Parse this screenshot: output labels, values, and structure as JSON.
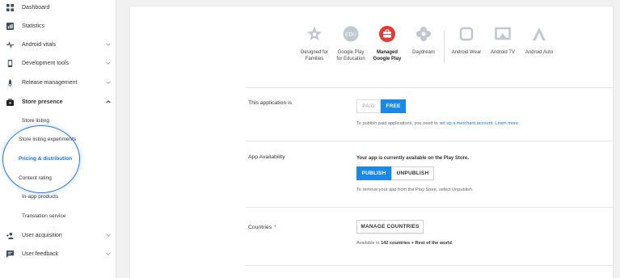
{
  "sidebar": {
    "items": [
      {
        "label": "Dashboard",
        "icon": "dashboard-icon",
        "chevron": false
      },
      {
        "label": "Statistics",
        "icon": "statistics-icon",
        "chevron": false
      },
      {
        "label": "Android vitals",
        "icon": "vitals-icon",
        "chevron": true
      },
      {
        "label": "Development tools",
        "icon": "dev-tools-icon",
        "chevron": true
      },
      {
        "label": "Release management",
        "icon": "rocket-icon",
        "chevron": true
      },
      {
        "label": "Store presence",
        "icon": "store-icon",
        "chevron": "up"
      },
      {
        "label": "User acquisition",
        "icon": "user-add-icon",
        "chevron": true
      },
      {
        "label": "User feedback",
        "icon": "feedback-icon",
        "chevron": true
      }
    ],
    "store_presence_sub": [
      "Store listing",
      "Store listing experiments",
      "Pricing & distribution",
      "Content rating",
      "In-app products",
      "Translation service"
    ],
    "active_sub": "Pricing & distribution"
  },
  "devices": [
    {
      "line1": "Designed for",
      "line2": "Families",
      "icon": "families-star-icon",
      "color": "#c2c8cf",
      "bold": false
    },
    {
      "line1": "Google Play",
      "line2": "for Education",
      "icon": "edu-icon",
      "color": "#c2c8cf",
      "bold": false
    },
    {
      "line1": "Managed",
      "line2": "Google Play",
      "icon": "briefcase-icon",
      "color": "#e53935",
      "bold": true
    },
    {
      "line1": "Daydream",
      "line2": "",
      "icon": "daydream-icon",
      "color": "#c2c8cf",
      "bold": false
    },
    {
      "line1": "Android Wear",
      "line2": "",
      "icon": "watch-icon",
      "color": "#c2c8cf",
      "bold": false
    },
    {
      "line1": "Android TV",
      "line2": "",
      "icon": "tv-icon",
      "color": "#c2c8cf",
      "bold": false
    },
    {
      "line1": "Android Auto",
      "line2": "",
      "icon": "auto-icon",
      "color": "#c2c8cf",
      "bold": false
    }
  ],
  "edu_text": "EDU",
  "pricing": {
    "label": "This application is",
    "paid": "PAID",
    "free": "FREE",
    "selected": "FREE",
    "help_prefix": "To publish paid applications, you need to ",
    "help_link1": "set up a merchant account",
    "help_mid": ". ",
    "help_link2": "Learn more"
  },
  "availability": {
    "label": "App Availability",
    "status": "Your app is currently available on the Play Store.",
    "publish": "PUBLISH",
    "unpublish": "UNPUBLISH",
    "help": "To remove your app from the Play Store, select Unpublish."
  },
  "countries": {
    "label": "Countries",
    "required": "*",
    "button": "MANAGE COUNTRIES",
    "avail_prefix": "Available in ",
    "avail_bold": "142 countries + Rest of the world",
    "avail_suffix": "."
  },
  "colors": {
    "accent": "#1a88e6",
    "link": "#1e6fd9",
    "managed_red": "#e53935"
  }
}
